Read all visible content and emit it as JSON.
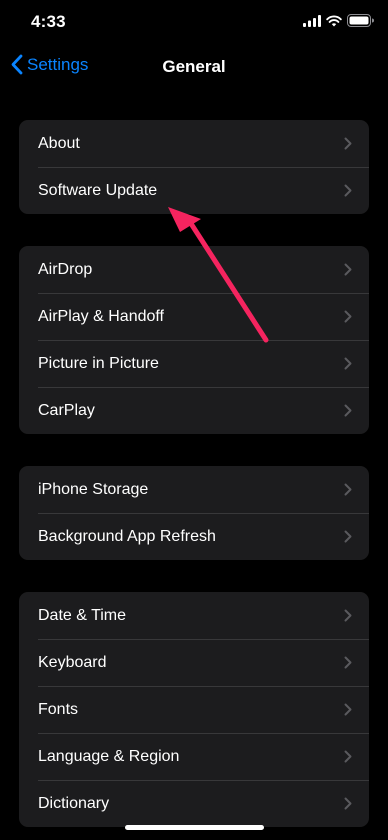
{
  "status_bar": {
    "time": "4:33",
    "icons": [
      "cellular-signal-icon",
      "wifi-icon",
      "battery-icon"
    ]
  },
  "nav": {
    "back_label": "Settings",
    "title": "General"
  },
  "groups": [
    {
      "items": [
        {
          "label": "About"
        },
        {
          "label": "Software Update"
        }
      ]
    },
    {
      "items": [
        {
          "label": "AirDrop"
        },
        {
          "label": "AirPlay & Handoff"
        },
        {
          "label": "Picture in Picture"
        },
        {
          "label": "CarPlay"
        }
      ]
    },
    {
      "items": [
        {
          "label": "iPhone Storage"
        },
        {
          "label": "Background App Refresh"
        }
      ]
    },
    {
      "items": [
        {
          "label": "Date & Time"
        },
        {
          "label": "Keyboard"
        },
        {
          "label": "Fonts"
        },
        {
          "label": "Language & Region"
        },
        {
          "label": "Dictionary"
        }
      ]
    }
  ],
  "annotation": {
    "arrow_color": "#f5245f",
    "points_to": "Software Update"
  },
  "colors": {
    "background": "#000000",
    "cell_background": "#1c1c1e",
    "accent": "#0a84ff",
    "separator": "#38383a",
    "chevron": "#5a5a5e"
  }
}
